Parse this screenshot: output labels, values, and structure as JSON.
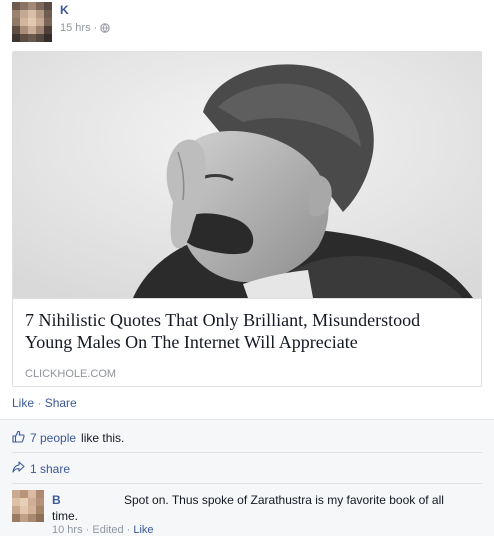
{
  "post": {
    "author": "K",
    "timestamp": "15 hrs",
    "separator": "·",
    "privacy_icon": "globe-icon"
  },
  "link_card": {
    "title": "7 Nihilistic Quotes That Only Brilliant, Misunderstood Young Males On The Internet Will Appreciate",
    "domain": "CLICKHOLE.COM"
  },
  "actions": {
    "like_label": "Like",
    "separator": "·",
    "share_label": "Share"
  },
  "ufi": {
    "likes_link": "7 people",
    "likes_suffix": "like this.",
    "shares_label": "1 share",
    "like_icon": "thumbs-up-icon",
    "share_icon": "share-arrow-icon"
  },
  "comment": {
    "author": "B",
    "text": "Spot on. Thus spoke of Zarathustra is my favorite book of all",
    "text_cont": "time.",
    "timestamp": "10 hrs",
    "edited": "Edited",
    "like_label": "Like",
    "separator": "·"
  },
  "colors": {
    "link": "#3b5998",
    "meta": "#9197a3",
    "ufi_background": "#f6f7f9"
  }
}
